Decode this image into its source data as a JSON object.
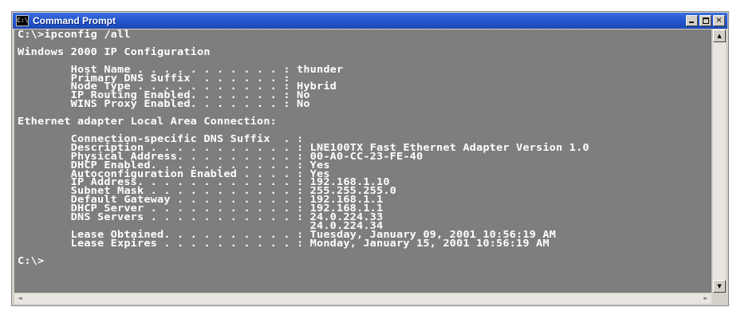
{
  "window": {
    "title": "Command Prompt",
    "icon_label": "C:\\",
    "controls": {
      "minimize": "minimize-icon",
      "maximize": "maximize-icon",
      "close": "×"
    }
  },
  "console": {
    "lines": [
      "C:\\>ipconfig /all",
      "",
      "Windows 2000 IP Configuration",
      "",
      "        Host Name . . . . . . . . . . . : thunder",
      "        Primary DNS Suffix  . . . . . . :",
      "        Node Type . . . . . . . . . . . : Hybrid",
      "        IP Routing Enabled. . . . . . . : No",
      "        WINS Proxy Enabled. . . . . . . : No",
      "",
      "Ethernet adapter Local Area Connection:",
      "",
      "        Connection-specific DNS Suffix  . :",
      "        Description . . . . . . . . . . . : LNE100TX Fast Ethernet Adapter Version 1.0",
      "        Physical Address. . . . . . . . . : 00-A0-CC-23-FE-40",
      "        DHCP Enabled. . . . . . . . . . . : Yes",
      "        Autoconfiguration Enabled . . . . : Yes",
      "        IP Address. . . . . . . . . . . . : 192.168.1.10",
      "        Subnet Mask . . . . . . . . . . . : 255.255.255.0",
      "        Default Gateway . . . . . . . . . : 192.168.1.1",
      "        DHCP Server . . . . . . . . . . . : 192.168.1.1",
      "        DNS Servers . . . . . . . . . . . : 24.0.224.33",
      "                                            24.0.224.34",
      "        Lease Obtained. . . . . . . . . . : Tuesday, January 09, 2001 10:56:19 AM",
      "        Lease Expires . . . . . . . . . . : Monday, January 15, 2001 10:56:19 AM",
      "",
      "C:\\>"
    ]
  },
  "colors": {
    "titlebar": "#2457cf",
    "console_background": "#7e7e7e",
    "console_text": "#ffffff"
  },
  "scrollbars": {
    "up_arrow": "▲",
    "down_arrow": "▼",
    "left_arrow": "◄",
    "right_arrow": "►"
  }
}
